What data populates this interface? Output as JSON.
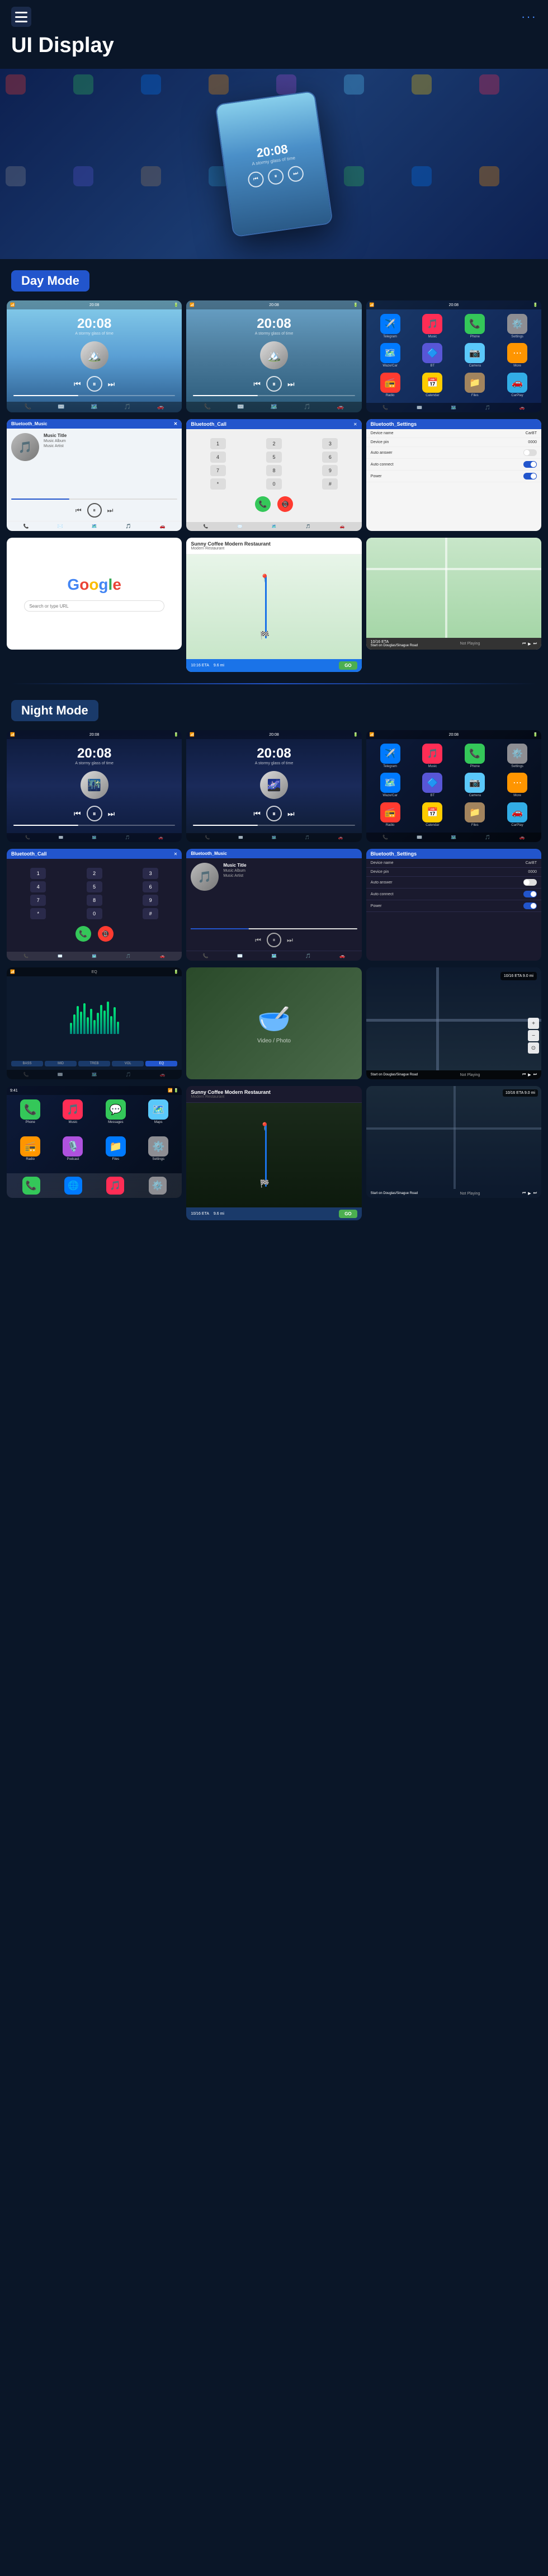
{
  "header": {
    "title": "UI Display",
    "menu_icon": "☰",
    "dots": "···"
  },
  "sections": {
    "day_mode": "Day Mode",
    "night_mode": "Night Mode"
  },
  "hero": {
    "time": "20:08",
    "subtitle": "A stormy glass of time"
  },
  "day_screenshots": [
    {
      "type": "music_player",
      "time": "20:08",
      "subtitle": "A stormy glass of time",
      "mode": "day"
    },
    {
      "type": "music_player",
      "time": "20:08",
      "subtitle": "A stormy glass of time",
      "mode": "day2"
    },
    {
      "type": "app_grid",
      "mode": "day"
    },
    {
      "type": "bluetooth_music",
      "title": "Bluetooth_Music",
      "track_title": "Music Title",
      "album": "Music Album",
      "artist": "Music Artist"
    },
    {
      "type": "bluetooth_call",
      "title": "Bluetooth_Call"
    },
    {
      "type": "bluetooth_settings",
      "title": "Bluetooth_Settings",
      "device_name_label": "Device name",
      "device_name_val": "CarBT",
      "device_pin_label": "Device pin",
      "device_pin_val": "0000",
      "auto_answer_label": "Auto answer",
      "auto_connect_label": "Auto connect",
      "power_label": "Power"
    },
    {
      "type": "google",
      "logo": "Google"
    },
    {
      "type": "map_navigation",
      "destination": "Sunny Coffee Modern Restaurant",
      "eta": "10:16 ETA",
      "distance": "9.6 mi",
      "button": "GO"
    },
    {
      "type": "not_playing",
      "eta": "10/16 ETA",
      "start": "Start on Douglas/Sinague Road",
      "status": "Not Playing"
    }
  ],
  "night_screenshots": [
    {
      "type": "music_player",
      "time": "20:08",
      "subtitle": "A stormy glass of time",
      "mode": "night"
    },
    {
      "type": "music_player",
      "time": "20:08",
      "subtitle": "A stormy glass of time",
      "mode": "night2"
    },
    {
      "type": "app_grid",
      "mode": "night"
    },
    {
      "type": "bluetooth_call_night",
      "title": "Bluetooth_Call"
    },
    {
      "type": "bluetooth_music_night",
      "title": "Bluetooth_Music",
      "track_title": "Music Title",
      "album": "Music Album",
      "artist": "Music Artist"
    },
    {
      "type": "bluetooth_settings_night",
      "title": "Bluetooth_Settings",
      "device_name_label": "Device name",
      "device_name_val": "CarBT",
      "device_pin_label": "Device pin",
      "device_pin_val": "0000",
      "auto_answer_label": "Auto answer",
      "auto_connect_label": "Auto connect",
      "power_label": "Power"
    },
    {
      "type": "waveform",
      "mode": "night"
    },
    {
      "type": "photo_video"
    },
    {
      "type": "map_night"
    },
    {
      "type": "ios_apps_night"
    },
    {
      "type": "nav_night",
      "eta": "10/16 ETA",
      "distance": "9.6 mi",
      "start": "Start on Douglas/Sinague Road",
      "status": "Not Playing"
    }
  ],
  "app_icons": {
    "phone": "📞",
    "music": "🎵",
    "messages": "💬",
    "maps": "🗺️",
    "settings": "⚙️",
    "camera": "📷",
    "photos": "🖼️",
    "files": "📁",
    "calendar": "📅",
    "clock": "🕐",
    "mail": "✉️",
    "browser": "🌐",
    "radio": "📻",
    "bluetooth": "🔷",
    "carplay": "🚗",
    "podcast": "🎙️"
  },
  "colors": {
    "day_bg": "#87ceeb",
    "night_bg": "#0d1a3a",
    "accent": "#2255cc",
    "header_bg": "#0a1628",
    "day_section": "#2255cc",
    "night_section": "#1a3a6a"
  }
}
